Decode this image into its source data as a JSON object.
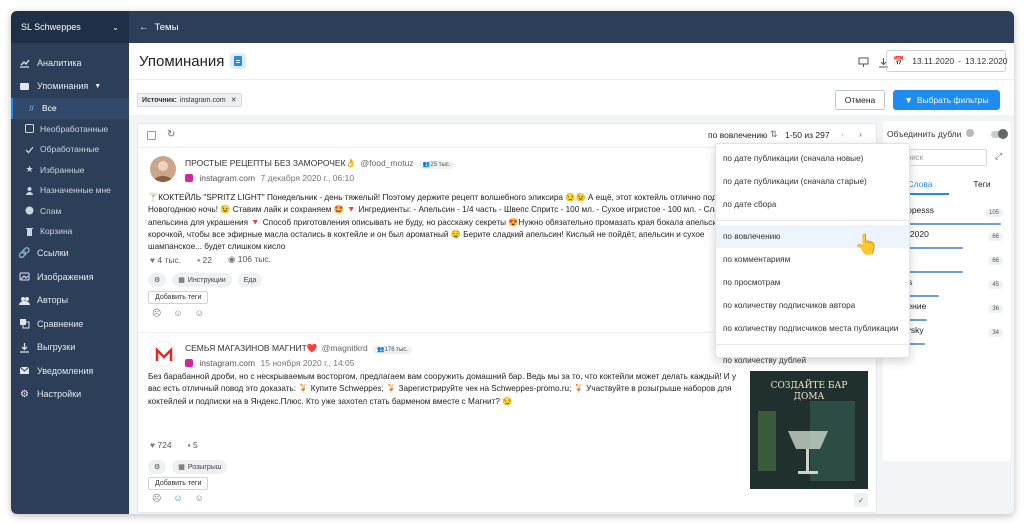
{
  "sidebar": {
    "brand": "SL Schweppes",
    "items": [
      {
        "label": "Аналитика",
        "icon": "chart-icon"
      },
      {
        "label": "Упоминания",
        "icon": "mentions-icon"
      },
      {
        "label": "Все",
        "icon": "all-icon"
      },
      {
        "label": "Необработанные",
        "icon": "inbox-icon"
      },
      {
        "label": "Обработанные",
        "icon": "check-icon"
      },
      {
        "label": "Избранные",
        "icon": "star-icon"
      },
      {
        "label": "Назначенные мне",
        "icon": "user-assigned-icon"
      },
      {
        "label": "Спам",
        "icon": "spam-icon"
      },
      {
        "label": "Корзина",
        "icon": "trash-icon"
      },
      {
        "label": "Ссылки",
        "icon": "link-icon"
      },
      {
        "label": "Изображения",
        "icon": "image-icon"
      },
      {
        "label": "Авторы",
        "icon": "authors-icon"
      },
      {
        "label": "Сравнение",
        "icon": "compare-icon"
      },
      {
        "label": "Выгрузки",
        "icon": "download-icon"
      },
      {
        "label": "Уведомления",
        "icon": "mail-icon"
      },
      {
        "label": "Настройки",
        "icon": "gear-icon"
      }
    ]
  },
  "topbar": {
    "back_label": "Темы"
  },
  "header": {
    "title": "Упоминания",
    "date_from": "13.11.2020",
    "date_to": "13.12.2020"
  },
  "filters": {
    "source_key": "Источник:",
    "source_value": "instagram.com",
    "cancel": "Отмена",
    "apply": "Выбрать фильтры"
  },
  "list": {
    "sort_label": "по вовлечению",
    "range": "1-50 из 297"
  },
  "sort_menu": [
    "по дате публикации (сначала новые)",
    "по дате публикации (сначала старые)",
    "по дате сбора",
    "по вовлечению",
    "по комментариям",
    "по просмотрам",
    "по количеству подписчиков автора",
    "по количеству подписчиков места публикации",
    "по количеству дублей"
  ],
  "posts": [
    {
      "name": "ПРОСТЫЕ РЕЦЕПТЫ БЕЗ ЗАМОРОЧЕК👌",
      "handle": "@food_motuz",
      "followers": "25 тыс.",
      "site": "instagram.com",
      "date": "7 декабря 2020 г., 06:10",
      "text": "🍸КОКТЕЙЛЬ \"SPRITZ LIGHT\" Понедельник - день тяжелый! Поэтому держите рецепт волшебного эликсира 😏😉 А ещё, этот коктейль отлично подойдёт в Новогоднюю ночь! 😉 Ставим лайк и сохраняем 🤩 🔻 Ингредиенты: - Апельсин - 1/4 часть - Швепс Спритс - 100 мл. - Сухое игристое - 100 мл. - Слайсы апельсина для украшения 🔻 Способ приготовления описывать не буду, но расскажу секреты 😍Нужно обязательно промазать края бокала апельсиновой корочкой, чтобы все эфирные масла остались в коктейле и он был ароматный 🤤 Берите сладкий апельсин! Кислый не пойдёт, апельсин и сухое шампанское... будет слишком кисло",
      "likes": "4 тыс.",
      "comments": "22",
      "views": "106 тыс.",
      "tags": [
        "Инструкции",
        "Еда"
      ],
      "add_tags": "Добавить теги"
    },
    {
      "name": "СЕМЬЯ МАГАЗИНОВ МАГНИТ❤️",
      "handle": "@magnitkrd",
      "followers": "176 тыс.",
      "site": "instagram.com",
      "date": "15 ноября 2020 г., 14:05",
      "text": "Без барабанной дроби, но с нескрываемым восторгом, предлагаем вам сооружить домашний бар. Ведь мы за то, что коктейли может делать каждый! И у вас есть отличный повод это доказать: 🍹 Купите Schweppes; 🍹 Зарегистрируйте чек на Schweppes-promo.ru; 🍹 Участвуйте в розыгрыше наборов для коктейлей и подписки на в Яндекс.Плюс. Кто уже захотел стать барменом вместе с Магнит? 😏",
      "likes": "724",
      "comments": "5",
      "tags": [
        "Розыгрыш"
      ],
      "add_tags": "Добавить теги",
      "image_caption": "СОЗДАЙТЕ БАР ДОМА"
    }
  ],
  "right": {
    "merge_label": "Объединить дубли",
    "search_placeholder": "Поиск",
    "tab_words": "Слова",
    "tab_tags": "Теги",
    "keywords": [
      {
        "word": "schweppesss",
        "count": "105"
      },
      {
        "word": "mpotiki2020",
        "count": "66"
      },
      {
        "word": "nc",
        "count": "66"
      },
      {
        "word": "weppes",
        "count": "45"
      },
      {
        "word": "одвижение",
        "count": "36"
      },
      {
        "word": "ogunovsky",
        "count": "34"
      }
    ]
  },
  "colors": {
    "sidebar": "#2c3e58",
    "accent": "#1e8cf0"
  }
}
